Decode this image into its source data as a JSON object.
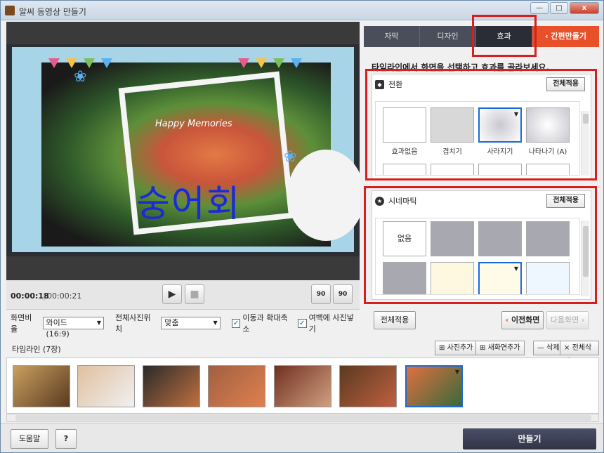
{
  "window": {
    "title": "알씨 동영상 만들기",
    "minimize_label": "—",
    "maximize_label": "□",
    "close_label": "x"
  },
  "preview": {
    "caption_text": "숭어회",
    "decor_text": "Happy Memories"
  },
  "playback": {
    "current_time": "00:00:18",
    "separator": "|",
    "total_time": "00:00:21",
    "play_label": "▶",
    "stop_label": "■",
    "rotate_left_label": "90",
    "rotate_right_label": "90"
  },
  "options": {
    "aspect_label": "화면비율",
    "aspect_value": "와이드 (16:9)",
    "photo_pos_label": "전체사진위치",
    "photo_pos_value": "맞춤",
    "move_zoom_label": "이동과 확대축소",
    "move_zoom_checked": true,
    "margin_fill_label": "여백에 사진넣기",
    "margin_fill_checked": true
  },
  "tabs": [
    {
      "label": "자막",
      "active": false
    },
    {
      "label": "디자인",
      "active": false
    },
    {
      "label": "효과",
      "active": true
    }
  ],
  "quick_make_label": "간편만들기",
  "instruction": "타임라인에서 화면을 선택하고 효과를 골라보세요.",
  "transition": {
    "title": "전환",
    "apply_all_label": "전체적용",
    "items": [
      {
        "label": "효과없음",
        "selected": false
      },
      {
        "label": "겹치기",
        "selected": false
      },
      {
        "label": "사라지기",
        "selected": true
      },
      {
        "label": "나타나기 (A)",
        "selected": false
      }
    ]
  },
  "cinematic": {
    "title": "시네마틱",
    "apply_all_label": "전체적용",
    "items": [
      {
        "label": "없음",
        "selected": false
      },
      {
        "label": "",
        "selected": false
      },
      {
        "label": "",
        "selected": false
      },
      {
        "label": "",
        "selected": false
      }
    ]
  },
  "apply_all_bottom_label": "전체적용",
  "prev_screen_label": "이전화면",
  "next_screen_label": "다음화면",
  "timeline": {
    "title": "타임라인 (7장)",
    "add_photo_label": "사진추가",
    "new_screen_label": "새화면추가",
    "delete_label": "삭제",
    "delete_all_label": "전체삭제",
    "frame_count": 7
  },
  "help_label": "도움말",
  "question_label": "?",
  "make_label": "만들기",
  "colors": {
    "accent": "#e8502a",
    "highlight": "#d81e1e",
    "selection": "#1a6ad8",
    "caption": "#1a2ad8"
  }
}
